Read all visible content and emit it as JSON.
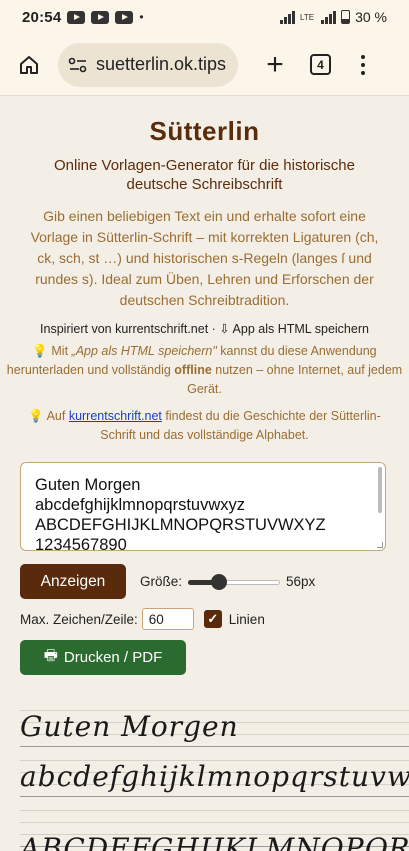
{
  "status_bar": {
    "time": "20:54",
    "battery": "30 %"
  },
  "browser": {
    "url": "suetterlin.ok.tips",
    "tab_count": "4"
  },
  "page": {
    "title": "Sütterlin",
    "subtitle": "Online Vorlagen-Generator für die historische deutsche Schreibschrift",
    "intro": "Gib einen beliebigen Text ein und erhalte sofort eine Vorlage in Sütterlin-Schrift – mit korrekten Ligaturen (ch, ck, sch, st …) und historischen s-Regeln (langes ſ und rundes s). Ideal zum Üben, Lehren und Erforschen der deutschen Schreibtradition.",
    "inspired_prefix": "Inspiriert von ",
    "inspired_link": "kurrentschrift.net",
    "inspired_sep": " · ",
    "save_link": "⇩ App als HTML speichern",
    "hint1_prefix": " Mit ",
    "hint1_em": "„App als HTML speichern\"",
    "hint1_mid": " kannst du diese Anwendung herunterladen und vollständig ",
    "hint1_bold": "offline",
    "hint1_suffix": " nutzen – ohne Internet, auf jedem Gerät.",
    "hint2_prefix": " Auf ",
    "hint2_link": "kurrentschrift.net",
    "hint2_suffix": " findest du die Geschichte der Sütterlin-Schrift und das vollständige Alphabet."
  },
  "editor": {
    "lines": [
      "Guten Morgen",
      "abcdefghijklmnopqrstuvwxyz",
      "ABCDEFGHIJKLMNOPQRSTUVWXYZ",
      "1234567890"
    ]
  },
  "controls": {
    "show_button": "Anzeigen",
    "size_label": "Größe:",
    "size_value": "56px",
    "size_fraction": 0.3,
    "max_chars_label": "Max. Zeichen/Zeile:",
    "max_chars_value": "60",
    "lines_label": "Linien",
    "lines_checked": true,
    "print_button": "Drucken / PDF"
  },
  "preview": {
    "lines": [
      "Guten Morgen",
      "abcdefghijklmnopqrstuvwxyz",
      "ABCDEFGHIJKLMNOPQRSTUVWXYZ"
    ]
  },
  "colors": {
    "brown": "#5a2a0c",
    "green": "#2c6b2f",
    "accent_text": "#9a6d33"
  }
}
